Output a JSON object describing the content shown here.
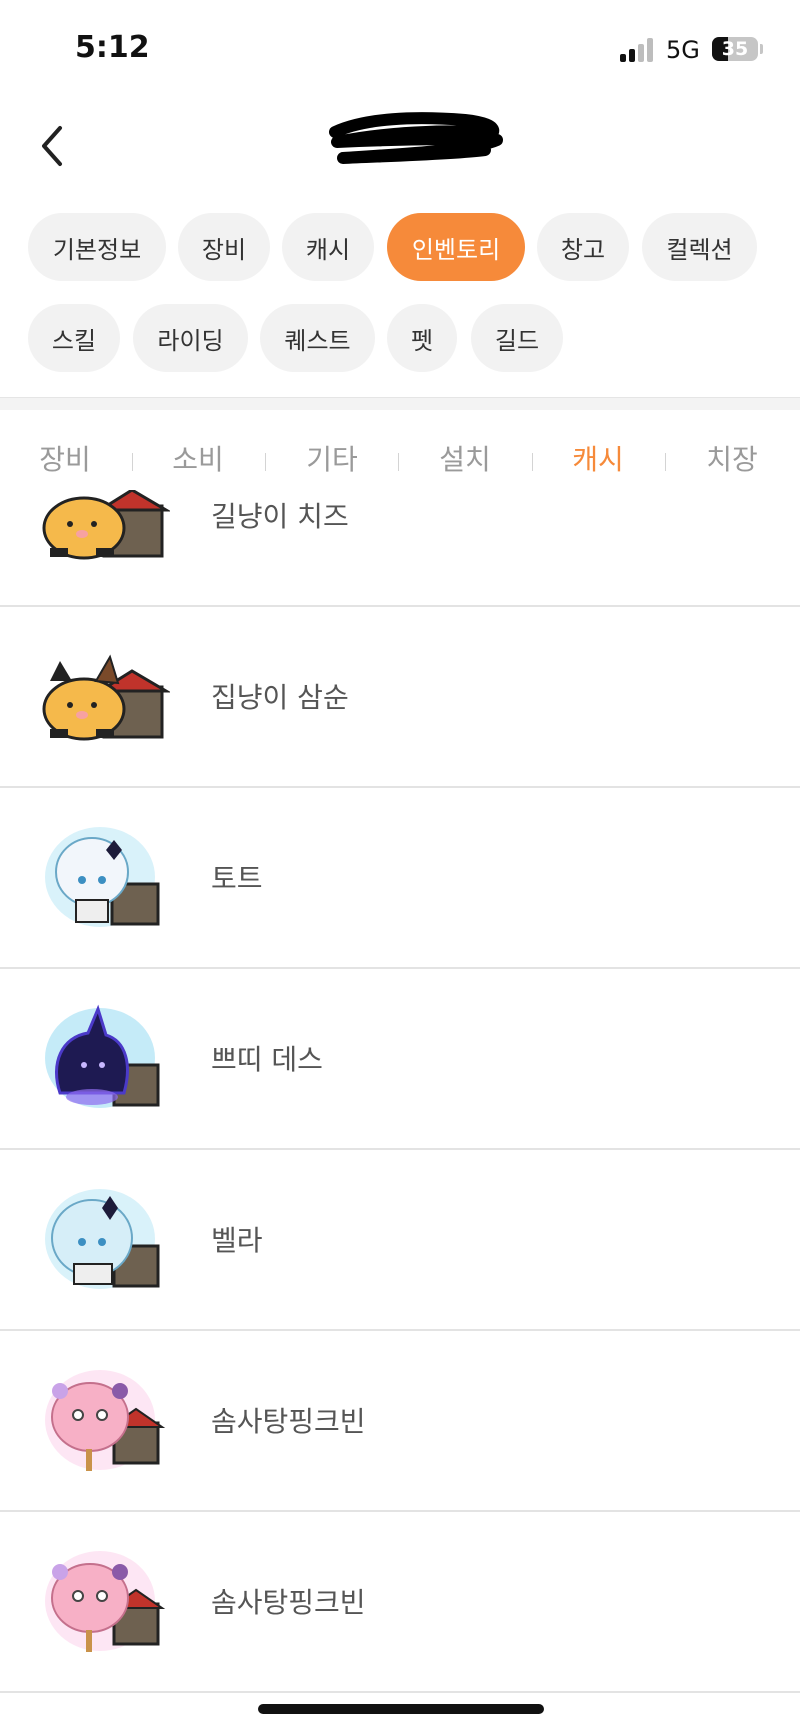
{
  "status_bar": {
    "time": "5:12",
    "network": "5G",
    "battery": "35",
    "battery_level": 0.35
  },
  "header": {
    "back_icon": "chevron-left-icon"
  },
  "category_tabs": [
    {
      "label": "기본정보",
      "active": false
    },
    {
      "label": "장비",
      "active": false
    },
    {
      "label": "캐시",
      "active": false
    },
    {
      "label": "인벤토리",
      "active": true
    },
    {
      "label": "창고",
      "active": false
    },
    {
      "label": "컬렉션",
      "active": false
    },
    {
      "label": "스킬",
      "active": false
    },
    {
      "label": "라이딩",
      "active": false
    },
    {
      "label": "퀘스트",
      "active": false
    },
    {
      "label": "펫",
      "active": false
    },
    {
      "label": "길드",
      "active": false
    }
  ],
  "sub_tabs": [
    {
      "label": "장비",
      "active": false
    },
    {
      "label": "소비",
      "active": false
    },
    {
      "label": "기타",
      "active": false
    },
    {
      "label": "설치",
      "active": false
    },
    {
      "label": "캐시",
      "active": true
    },
    {
      "label": "치장",
      "active": false
    }
  ],
  "items": [
    {
      "name": "길냥이 치즈",
      "icon": "cheese-cat-pet-icon"
    },
    {
      "name": "집냥이 삼순",
      "icon": "calico-cat-pet-icon"
    },
    {
      "name": "토트",
      "icon": "white-hair-pet-icon"
    },
    {
      "name": "쁘띠 데스",
      "icon": "dark-spirit-pet-icon"
    },
    {
      "name": "벨라",
      "icon": "blue-hair-pet-icon"
    },
    {
      "name": "솜사탕핑크빈",
      "icon": "pink-bean-pet-icon"
    },
    {
      "name": "솜사탕핑크빈",
      "icon": "pink-bean-pet-icon"
    }
  ],
  "colors": {
    "accent": "#f68a3a",
    "chip_bg": "#f2f2f2",
    "divider": "#e3e3e3",
    "inactive_text": "#9a9a9a"
  }
}
